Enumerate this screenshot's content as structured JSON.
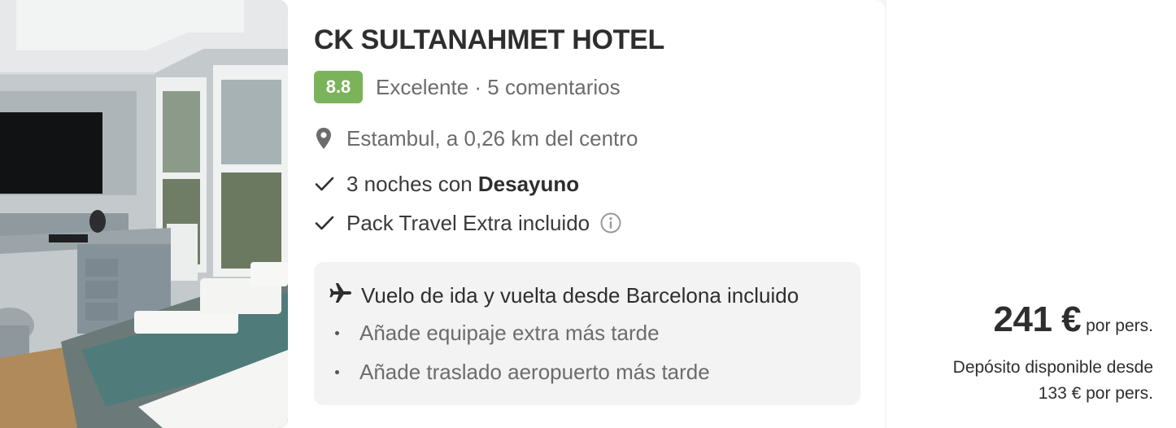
{
  "hotel": {
    "name": "CK SULTANAHMET HOTEL",
    "score": "8.8",
    "rating_text": "Excelente · 5 comentarios",
    "location": "Estambul, a 0,26 km del centro",
    "meals_prefix": "3 noches con ",
    "meals_bold": "Desayuno",
    "pack": "Pack Travel Extra incluido"
  },
  "flight": {
    "title": "Vuelo de ida y vuelta desde Barcelona incluido",
    "extras": [
      "Añade equipaje extra más tarde",
      "Añade traslado aeropuerto más tarde"
    ]
  },
  "price": {
    "amount": "241 €",
    "unit": "por pers.",
    "deposit_line1": "Depósito disponible desde",
    "deposit_line2": "133 € por pers."
  },
  "colors": {
    "score_badge": "#7bb35a",
    "flight_box_bg": "#f3f3f3"
  },
  "icons": {
    "location": "map-pin-icon",
    "check": "check-icon",
    "info": "info-icon",
    "plane": "plane-icon",
    "bullet": "dot-icon"
  }
}
